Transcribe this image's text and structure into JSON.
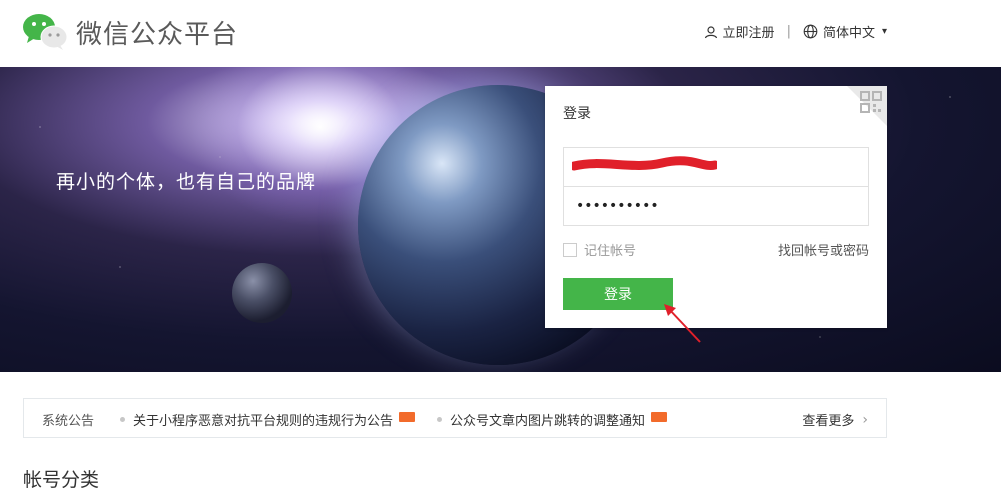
{
  "header": {
    "brand": "微信公众平台",
    "register": "立即注册",
    "separator": "|",
    "language": "简体中文"
  },
  "banner": {
    "slogan": "再小的个体，也有自己的品牌"
  },
  "login": {
    "title": "登录",
    "username_value": "",
    "password_value": "••••••••••",
    "remember_label": "记住帐号",
    "forgot_link": "找回帐号或密码",
    "submit_label": "登录"
  },
  "notice": {
    "label": "系统公告",
    "items": [
      {
        "text": "关于小程序恶意对抗平台规则的违规行为公告"
      },
      {
        "text": "公众号文章内图片跳转的调整通知"
      }
    ],
    "more": "查看更多"
  },
  "section": {
    "title": "帐号分类"
  },
  "colors": {
    "accent_green": "#44b549",
    "badge_orange": "#f26b2b",
    "annotation_red": "#e0202a"
  }
}
